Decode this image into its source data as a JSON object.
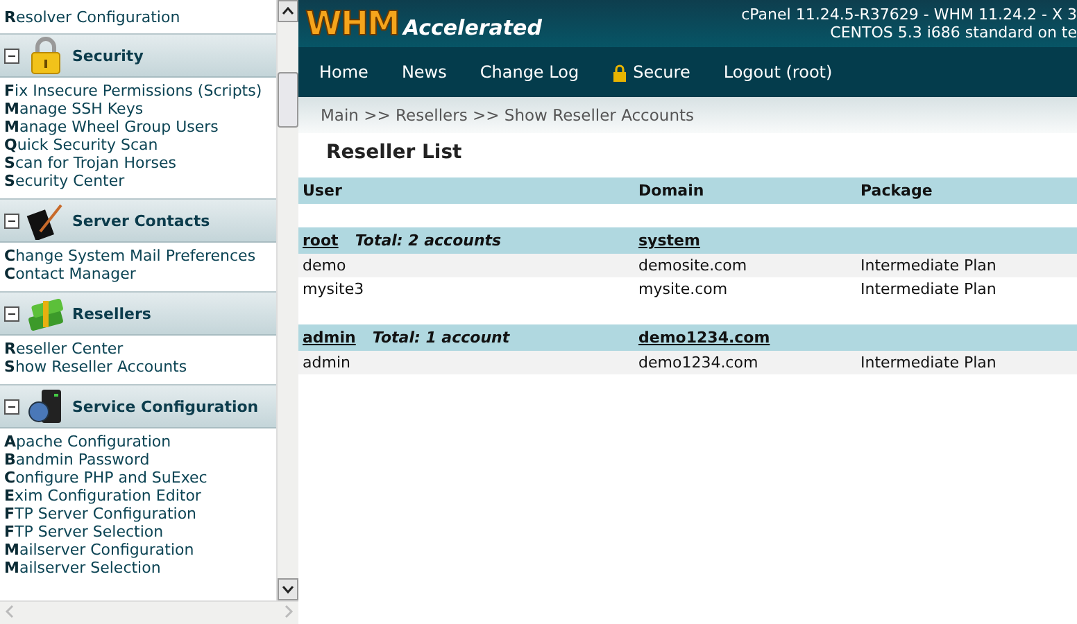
{
  "sidebar": {
    "top_items": [
      "**R**esolver Configuration"
    ],
    "sections": [
      {
        "title": "Security",
        "kind": "lock",
        "expanded": true,
        "items": [
          "**F**ix Insecure Permissions (Scripts)",
          "**M**anage SSH Keys",
          "**M**anage Wheel Group Users",
          "**Q**uick Security Scan",
          "**S**can for Trojan Horses",
          "**S**ecurity Center"
        ]
      },
      {
        "title": "Server Contacts",
        "kind": "notebook",
        "expanded": true,
        "items": [
          "**C**hange System Mail Preferences",
          "**C**ontact Manager"
        ]
      },
      {
        "title": "Resellers",
        "kind": "money",
        "expanded": true,
        "items": [
          "**R**eseller Center",
          "**S**how Reseller Accounts"
        ]
      },
      {
        "title": "Service Configuration",
        "kind": "server",
        "expanded": true,
        "items": [
          "**A**pache Configuration",
          "**B**andmin Password",
          "**C**onfigure PHP and SuExec",
          "**E**xim Configuration Editor",
          "**F**TP Server Configuration",
          "**F**TP Server Selection",
          "**M**ailserver Configuration",
          "**M**ailserver Selection"
        ]
      }
    ]
  },
  "header": {
    "logo_main": "WHM",
    "logo_sub": "Accelerated",
    "version_lines": [
      "cPanel 11.24.5-R37629 - WHM 11.24.2 - X 3",
      "CENTOS 5.3 i686 standard on te"
    ]
  },
  "nav": [
    {
      "label": "Home",
      "kind": "plain"
    },
    {
      "label": "News",
      "kind": "plain"
    },
    {
      "label": "Change Log",
      "kind": "plain"
    },
    {
      "label": "Secure",
      "kind": "lock"
    },
    {
      "label": "Logout (root)",
      "kind": "plain"
    }
  ],
  "breadcrumb": "Main >> Resellers >> Show Reseller Accounts",
  "title": "Reseller List",
  "table": {
    "columns": [
      "User",
      "Domain",
      "Package"
    ],
    "groups": [
      {
        "owner": "root",
        "total": "Total: 2 accounts",
        "domain": "system",
        "rows": [
          [
            "demo",
            "demosite.com",
            "Intermediate Plan"
          ],
          [
            "mysite3",
            "mysite.com",
            "Intermediate Plan"
          ]
        ]
      },
      {
        "owner": "admin",
        "total": "Total: 1 account",
        "domain": "demo1234.com",
        "rows": [
          [
            "admin",
            "demo1234.com",
            "Intermediate Plan"
          ]
        ]
      }
    ]
  }
}
